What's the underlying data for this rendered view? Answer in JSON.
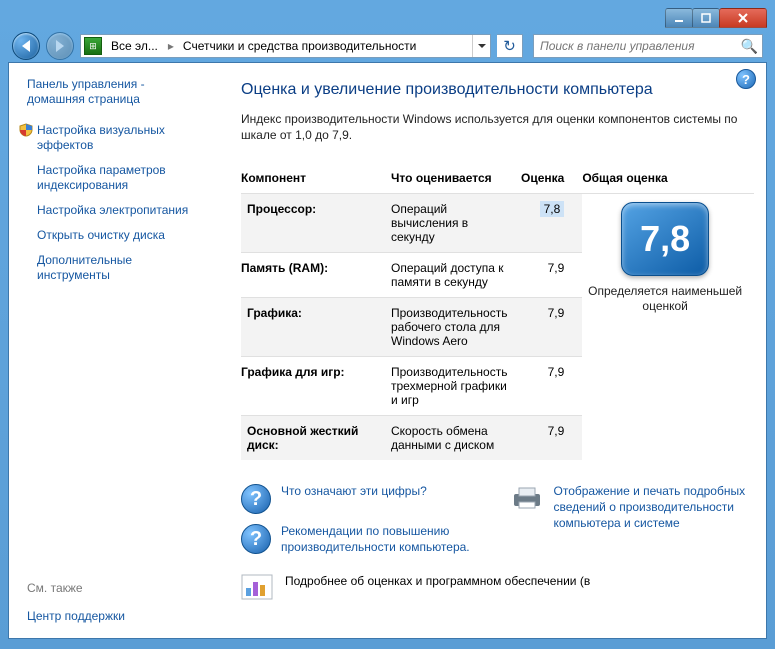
{
  "breadcrumb": {
    "seg1": "Все эл...",
    "seg2": "Счетчики и средства производительности"
  },
  "search": {
    "placeholder": "Поиск в панели управления"
  },
  "sidebar": {
    "home": "Панель управления - домашняя страница",
    "links": [
      "Настройка визуальных эффектов",
      "Настройка параметров индексирования",
      "Настройка электропитания",
      "Открыть очистку диска",
      "Дополнительные инструменты"
    ],
    "see_also_heading": "См. также",
    "see_also": "Центр поддержки"
  },
  "main": {
    "title": "Оценка и увеличение производительности компьютера",
    "intro": "Индекс производительности Windows используется для оценки компонентов системы по шкале от 1,0 до 7,9.",
    "headers": {
      "component": "Компонент",
      "what": "Что оценивается",
      "score": "Оценка",
      "base": "Общая оценка"
    },
    "rows": [
      {
        "name": "Процессор:",
        "what": "Операций вычисления в секунду",
        "score": "7,8"
      },
      {
        "name": "Память (RAM):",
        "what": "Операций доступа к памяти в секунду",
        "score": "7,9"
      },
      {
        "name": "Графика:",
        "what": "Производительность рабочего стола для Windows Aero",
        "score": "7,9"
      },
      {
        "name": "Графика для игр:",
        "what": "Производительность трехмерной графики и игр",
        "score": "7,9"
      },
      {
        "name": "Основной жесткий диск:",
        "what": "Скорость обмена данными с диском",
        "score": "7,9"
      }
    ],
    "base_score": "7,8",
    "base_caption": "Определяется наименьшей оценкой",
    "links": {
      "what_mean": "Что означают эти цифры?",
      "tips": "Рекомендации по повышению производительности компьютера.",
      "print": "Отображение и печать подробных сведений о производительности компьютера и системе",
      "more": "Подробнее об оценках и программном обеспечении (в"
    }
  }
}
